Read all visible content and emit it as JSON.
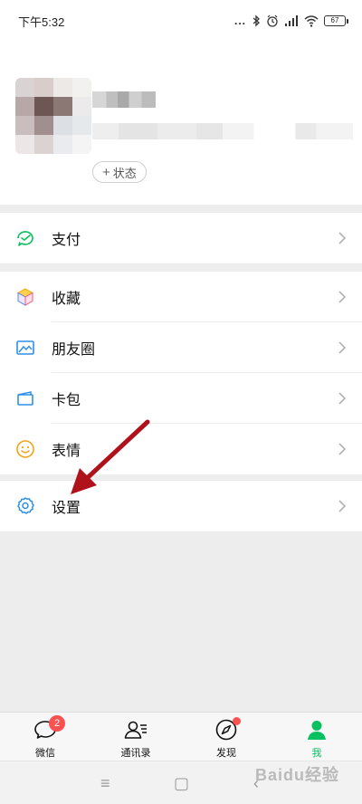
{
  "status_bar": {
    "time": "下午5:32",
    "dots": "...",
    "battery": "67"
  },
  "profile": {
    "status_button_label": "状态",
    "status_button_icon": "plus-icon"
  },
  "menu": {
    "pay": {
      "label": "支付",
      "icon": "pay-icon"
    },
    "favorites": {
      "label": "收藏",
      "icon": "favorites-cube-icon"
    },
    "moments": {
      "label": "朋友圈",
      "icon": "photo-icon"
    },
    "cards": {
      "label": "卡包",
      "icon": "wallet-icon"
    },
    "stickers": {
      "label": "表情",
      "icon": "smiley-icon"
    },
    "settings": {
      "label": "设置",
      "icon": "gear-icon"
    }
  },
  "tabbar": {
    "items": [
      {
        "label": "微信",
        "icon": "chat-bubble-icon",
        "badge": "2"
      },
      {
        "label": "通讯录",
        "icon": "contacts-icon"
      },
      {
        "label": "发现",
        "icon": "compass-icon"
      },
      {
        "label": "我",
        "icon": "me-person-icon"
      }
    ]
  },
  "system_nav": {
    "menu_glyph": "≡",
    "home_glyph": "▢",
    "back_glyph": "‹"
  },
  "watermark": "Baidu经验",
  "colors": {
    "accent_green": "#07c160",
    "badge_red": "#fa5151",
    "arrow_red": "#b0121b",
    "background_gray": "#ededed"
  }
}
